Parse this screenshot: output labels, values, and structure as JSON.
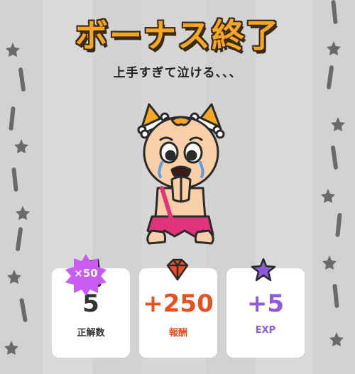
{
  "title": "ボーナス終了",
  "subtitle": "上手すぎて泣ける、、、",
  "colors": {
    "title": "#f5a623",
    "reward": "#e8501e",
    "exp": "#8e5ad9",
    "badge": "#c95bf0"
  },
  "multiplier_badge": "×50",
  "stats": {
    "correct": {
      "value": "5",
      "label": "正解数",
      "icon": "stone-axe-icon"
    },
    "reward": {
      "value": "+250",
      "label": "報酬",
      "icon": "red-gem-icon"
    },
    "exp": {
      "value": "+5",
      "label": "EXP",
      "icon": "purple-star-icon"
    }
  }
}
